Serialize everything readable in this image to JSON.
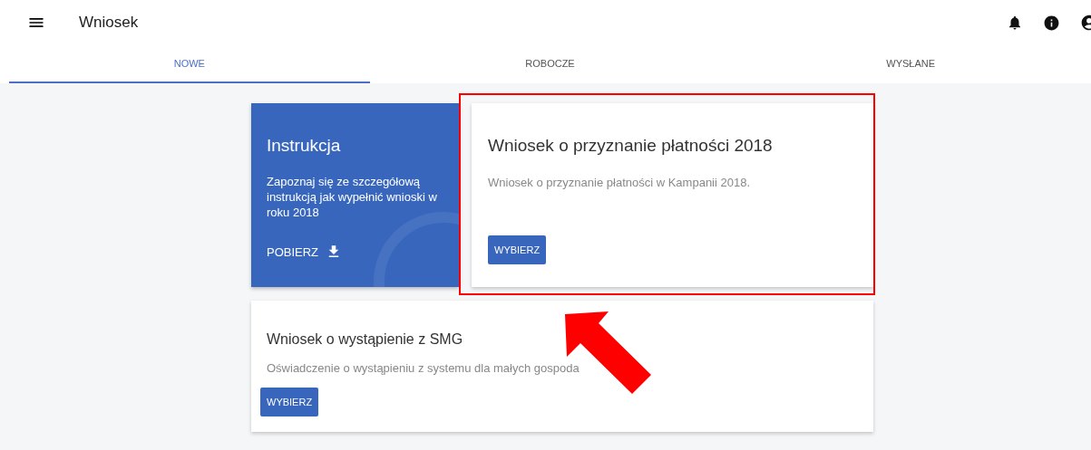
{
  "header": {
    "title": "Wniosek"
  },
  "tabs": [
    {
      "label": "NOWE",
      "selected": true
    },
    {
      "label": "ROBOCZE",
      "selected": false
    },
    {
      "label": "WYSŁANE",
      "selected": false
    }
  ],
  "instruction": {
    "title": "Instrukcja",
    "text": "Zapoznaj się ze szczegółową instrukcją jak wypełnić wnioski w roku 2018",
    "action": "POBIERZ"
  },
  "cards": [
    {
      "title": "Wniosek o przyznanie płatności 2018",
      "text": "Wniosek o przyznanie płatności w Kampanii 2018.",
      "button": "WYBIERZ",
      "highlighted": true
    },
    {
      "title": "Wniosek o wystąpienie z SMG",
      "text": "Oświadczenie o wystąpieniu z systemu dla małych gospoda",
      "button": "WYBIERZ",
      "highlighted": false,
      "arrow": true
    }
  ]
}
